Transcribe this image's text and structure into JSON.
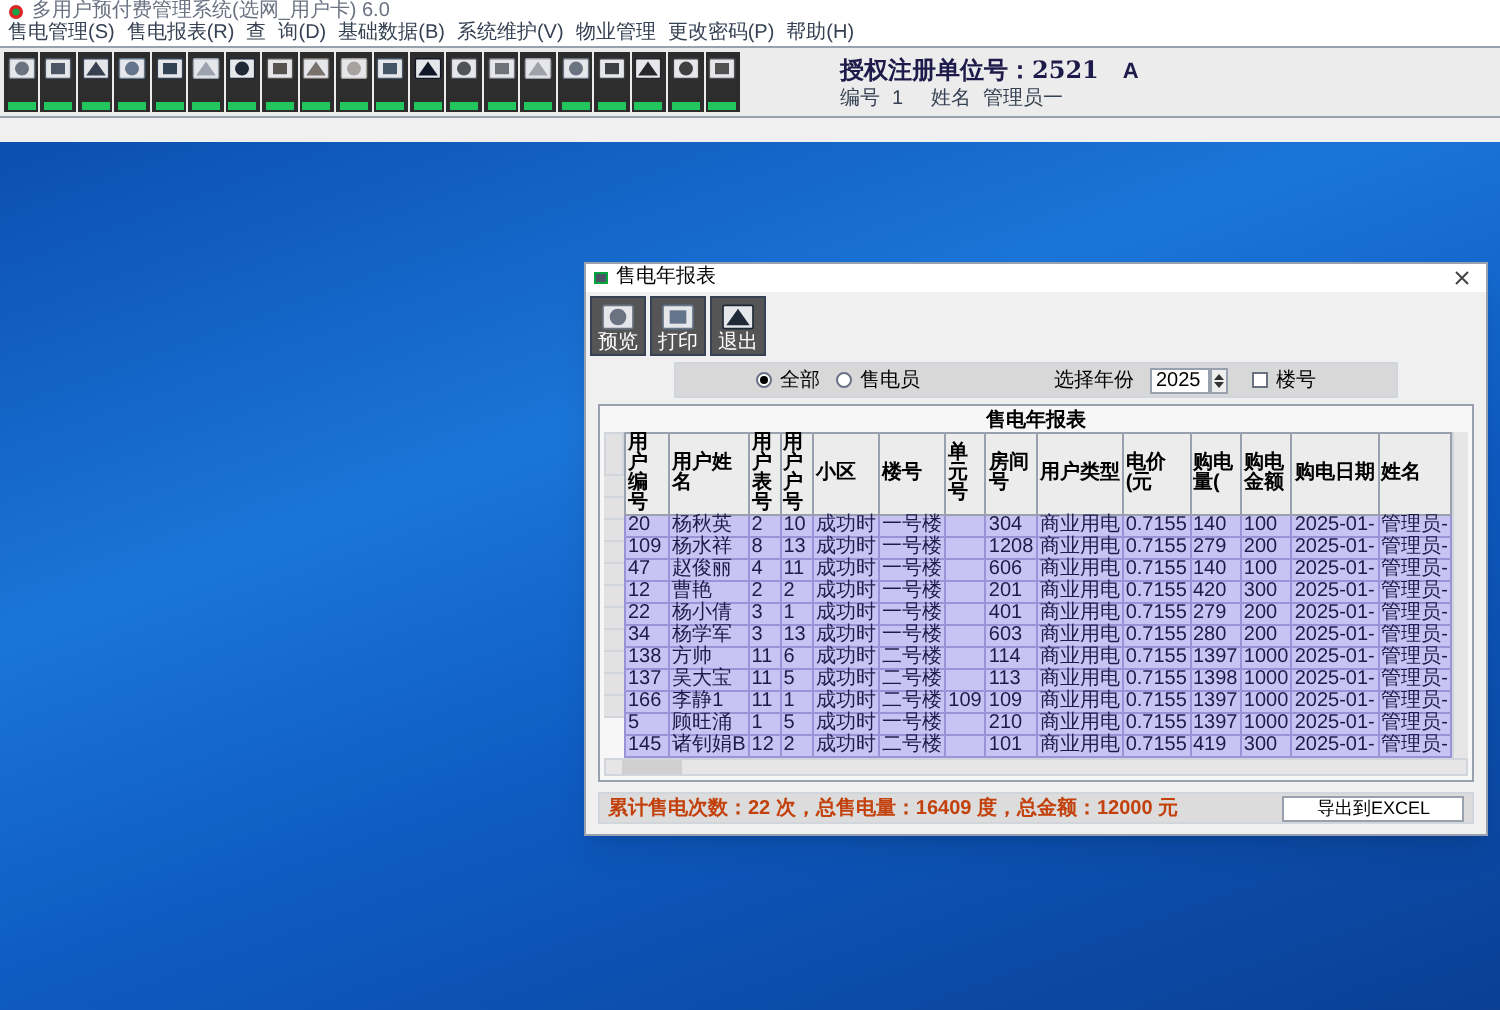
{
  "window": {
    "title": "多用户预付费管理系统(选网_用户卡) 6.0"
  },
  "menu": [
    "售电管理(S)",
    "售电报表(R)",
    "查",
    "询(D)",
    "基础数据(B)",
    "系统维护(V)",
    "物业管理",
    "更改密码(P)",
    "帮助(H)"
  ],
  "header": {
    "auth_title": "授权注册单位号：2521",
    "auth_flag": "A",
    "id_label": "编号",
    "id": "1",
    "name_label": "姓名",
    "name": "管理员一"
  },
  "dialog": {
    "title": "售电年报表",
    "tools": [
      "预览",
      "打印",
      "退出"
    ],
    "filter": {
      "radios": [
        {
          "label": "全部",
          "selected": true
        },
        {
          "label": "售电员",
          "selected": false
        }
      ],
      "year_label": "选择年份",
      "year": "2025",
      "building_checkbox": {
        "label": "楼号",
        "checked": false
      }
    },
    "table": {
      "title": "售电年报表",
      "columns": [
        "用户编号",
        "用户姓名",
        "用户表号",
        "用户户号",
        "小区",
        "楼号",
        "单元号",
        "房间号",
        "用户类型",
        "电价(元",
        "购电量(",
        "购电金额",
        "购电日期",
        "姓名"
      ],
      "rows": [
        [
          "20",
          "杨秋英",
          "2",
          "10",
          "成功时",
          "一号楼",
          "",
          "304",
          "商业用电",
          "0.7155",
          "140",
          "100",
          "2025-01-",
          "管理员-"
        ],
        [
          "109",
          "杨水祥",
          "8",
          "13",
          "成功时",
          "一号楼",
          "",
          "1208",
          "商业用电",
          "0.7155",
          "279",
          "200",
          "2025-01-",
          "管理员-"
        ],
        [
          "47",
          "赵俊丽",
          "4",
          "11",
          "成功时",
          "一号楼",
          "",
          "606",
          "商业用电",
          "0.7155",
          "140",
          "100",
          "2025-01-",
          "管理员-"
        ],
        [
          "12",
          "曹艳",
          "2",
          "2",
          "成功时",
          "一号楼",
          "",
          "201",
          "商业用电",
          "0.7155",
          "420",
          "300",
          "2025-01-",
          "管理员-"
        ],
        [
          "22",
          "杨小倩",
          "3",
          "1",
          "成功时",
          "一号楼",
          "",
          "401",
          "商业用电",
          "0.7155",
          "279",
          "200",
          "2025-01-",
          "管理员-"
        ],
        [
          "34",
          "杨学军",
          "3",
          "13",
          "成功时",
          "一号楼",
          "",
          "603",
          "商业用电",
          "0.7155",
          "280",
          "200",
          "2025-01-",
          "管理员-"
        ],
        [
          "138",
          "方帅",
          "11",
          "6",
          "成功时",
          "二号楼",
          "",
          "114",
          "商业用电",
          "0.7155",
          "1397",
          "1000",
          "2025-01-",
          "管理员-"
        ],
        [
          "137",
          "吴大宝",
          "11",
          "5",
          "成功时",
          "二号楼",
          "",
          "113",
          "商业用电",
          "0.7155",
          "1398",
          "1000",
          "2025-01-",
          "管理员-"
        ],
        [
          "166",
          "李静1",
          "11",
          "1",
          "成功时",
          "二号楼",
          "109",
          "109",
          "商业用电",
          "0.7155",
          "1397",
          "1000",
          "2025-01-",
          "管理员-"
        ],
        [
          "5",
          "顾旺涌",
          "1",
          "5",
          "成功时",
          "一号楼",
          "",
          "210",
          "商业用电",
          "0.7155",
          "1397",
          "1000",
          "2025-01-",
          "管理员-"
        ],
        [
          "145",
          "诸钊娟B",
          "12",
          "2",
          "成功时",
          "二号楼",
          "",
          "101",
          "商业用电",
          "0.7155",
          "419",
          "300",
          "2025-01-",
          "管理员-"
        ]
      ]
    },
    "summary": "累计售电次数：22 次，总售电量：16409 度，总金额：12000 元",
    "export_button": "导出到EXCEL"
  }
}
